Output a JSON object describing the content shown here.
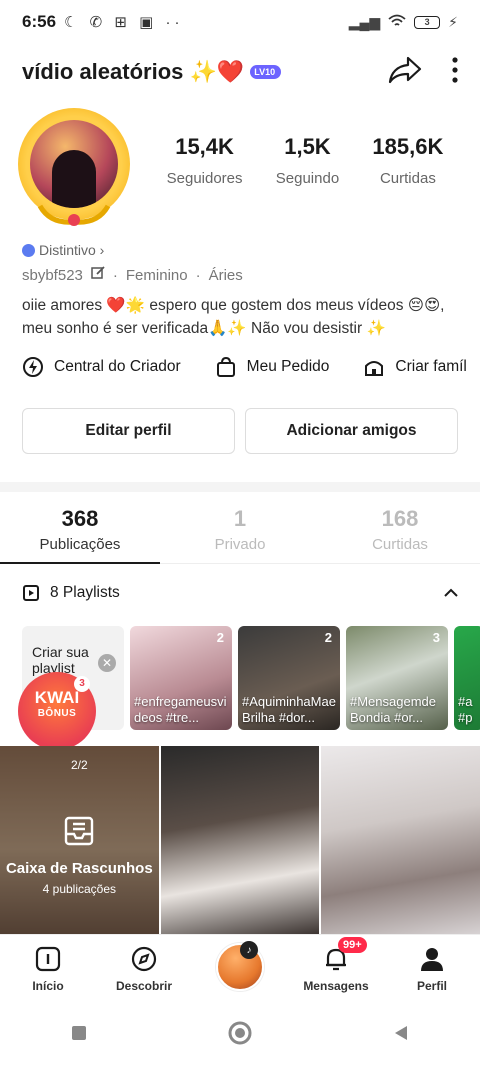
{
  "status_bar": {
    "time": "6:56",
    "battery": "3"
  },
  "header": {
    "title": "vídio aleatórios ✨❤️",
    "level": "LV10"
  },
  "stats": [
    {
      "value": "15,4K",
      "label": "Seguidores"
    },
    {
      "value": "1,5K",
      "label": "Seguindo"
    },
    {
      "value": "185,6K",
      "label": "Curtidas"
    }
  ],
  "profile": {
    "distintivo": "Distintivo ›",
    "username": "sbybf523",
    "gender": "Feminino",
    "sign": "Áries",
    "dot": "·",
    "bio": "oiie amores ❤️🌟 espero que gostem dos meus vídeos 😔😍, meu sonho é ser verificada🙏✨ Não vou desistir ✨"
  },
  "tools": [
    {
      "label": "Central do Criador",
      "icon": "lightning-circle-icon"
    },
    {
      "label": "Meu Pedido",
      "icon": "shopping-bag-icon"
    },
    {
      "label": "Criar famíl",
      "icon": "house-icon"
    }
  ],
  "buttons": {
    "edit": "Editar perfil",
    "add_friends": "Adicionar amigos"
  },
  "tabs": [
    {
      "count": "368",
      "label": "Publicações"
    },
    {
      "count": "1",
      "label": "Privado"
    },
    {
      "count": "168",
      "label": "Curtidas"
    }
  ],
  "playlists": {
    "header": "8 Playlists",
    "create_label": "Criar sua playlist",
    "items": [
      {
        "count": "2",
        "caption": "#enfregameusvideos #tre..."
      },
      {
        "count": "2",
        "caption": "#AquiminhaMaeBrilha #dor..."
      },
      {
        "count": "3",
        "caption": "#MensagemdeBondia #or..."
      },
      {
        "count": "",
        "caption": "#a #p"
      }
    ]
  },
  "kwai_bonus": {
    "line1": "KWAI",
    "line2": "BÔNUS",
    "badge": "3"
  },
  "grid": {
    "draft_page": "2/2",
    "draft_title": "Caixa de Rascunhos",
    "draft_count": "4 publicações"
  },
  "bottom_nav": {
    "home": "Início",
    "discover": "Descobrir",
    "messages": "Mensagens",
    "messages_badge": "99+",
    "profile": "Perfil"
  }
}
